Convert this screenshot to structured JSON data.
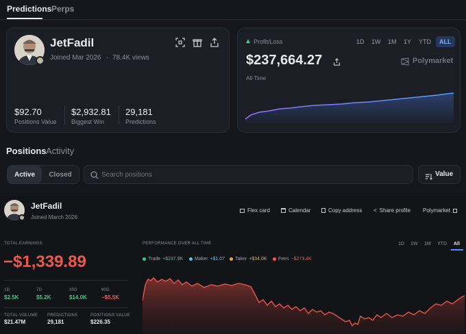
{
  "top_tabs": [
    "Predictions",
    "Perps"
  ],
  "profile": {
    "name": "JetFadil",
    "joined": "Joined Mar 2026",
    "views": "78.4K views",
    "sep": "·",
    "stats": [
      {
        "value": "$92.70",
        "label": "Positions Value"
      },
      {
        "value": "$2,932.81",
        "label": "Biggest Win"
      },
      {
        "value": "29,181",
        "label": "Predictions"
      }
    ]
  },
  "pnl": {
    "label": "Profit/Loss",
    "value": "$237,664.27",
    "period": "All-Time",
    "brand": "Polymarket",
    "ranges": [
      "1D",
      "1W",
      "1M",
      "1Y",
      "YTD",
      "ALL"
    ],
    "active_range": "ALL"
  },
  "section_tabs": [
    "Positions",
    "Activity"
  ],
  "filter": {
    "active": "Active",
    "closed": "Closed",
    "search_placeholder": "Search positions",
    "sort": "Value"
  },
  "embed": {
    "name": "JetFadil",
    "joined": "Joined March 2026",
    "actions": [
      "Flex card",
      "Calendar",
      "Copy address",
      "Share profile",
      "Polymarket"
    ],
    "total_earnings_label": "TOTAL EARNINGS",
    "total_earnings": "−$1,339.89",
    "periods": [
      {
        "label": "1D",
        "value": "$2.5K",
        "color": "#4cc38a"
      },
      {
        "label": "7D",
        "value": "$5.2K",
        "color": "#4cc38a"
      },
      {
        "label": "30D",
        "value": "$14.0K",
        "color": "#4cc38a"
      },
      {
        "label": "90D",
        "value": "−$5.5K",
        "color": "#f0574b"
      }
    ],
    "totals": [
      {
        "label": "TOTAL VOLUME",
        "value": "$21.47M"
      },
      {
        "label": "PREDICTIONS",
        "value": "29,181"
      },
      {
        "label": "POSITIONS VALUE",
        "value": "$226.35"
      }
    ],
    "perf_label": "PERFORMANCE OVER ALL TIME",
    "ranges": [
      "1D",
      "1W",
      "1M",
      "YTD",
      "All"
    ],
    "active_range": "All",
    "legend": [
      {
        "name": "Trade",
        "value": "+$237.9K",
        "color": "#4cc38a"
      },
      {
        "name": "Maker",
        "value": "+$1.07",
        "color": "#5cc3f0"
      },
      {
        "name": "Taker",
        "value": "+$34.0K",
        "color": "#f0a64b"
      },
      {
        "name": "Fees",
        "value": "−$273.4K",
        "color": "#f0574b"
      }
    ]
  },
  "colors": {
    "accent": "#5b8cff",
    "positive": "#4cc38a",
    "negative": "#f0574b",
    "bg": "#15171c"
  }
}
